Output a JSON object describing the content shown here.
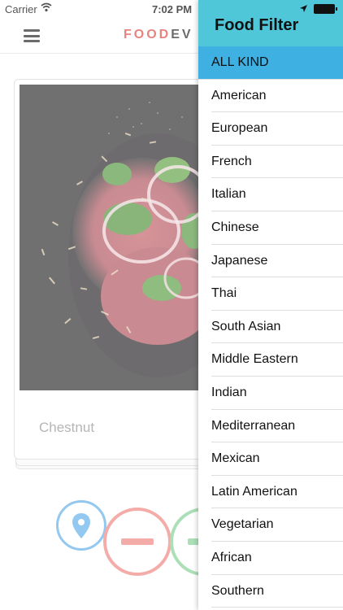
{
  "status_bar": {
    "carrier": "Carrier",
    "time": "7:02 PM"
  },
  "app_bar": {
    "logo_part1": "FOOD",
    "logo_part2": "EV"
  },
  "card": {
    "name": "Chestnut"
  },
  "drawer": {
    "title": "Food Filter",
    "items": [
      {
        "label": "ALL KIND",
        "selected": true
      },
      {
        "label": "American"
      },
      {
        "label": "European"
      },
      {
        "label": "French"
      },
      {
        "label": "Italian"
      },
      {
        "label": "Chinese"
      },
      {
        "label": "Japanese"
      },
      {
        "label": "Thai"
      },
      {
        "label": "South Asian"
      },
      {
        "label": "Middle Eastern"
      },
      {
        "label": "Indian"
      },
      {
        "label": "Mediterranean"
      },
      {
        "label": "Mexican"
      },
      {
        "label": "Latin American"
      },
      {
        "label": "Vegetarian"
      },
      {
        "label": "African"
      },
      {
        "label": "Southern"
      }
    ]
  },
  "colors": {
    "drawer_header": "#4fc7d8",
    "selected_item": "#3fb0e2",
    "logo_accent": "#e05550",
    "location_button": "#6ab3ea",
    "dislike_button": "#ef8d86",
    "like_button": "#8bd39d"
  },
  "icons": {
    "menu": "hamburger-icon",
    "wifi": "wifi-icon",
    "location": "map-pin-icon",
    "dislike": "minus-icon",
    "battery": "battery-icon",
    "location_services": "location-arrow-icon"
  }
}
